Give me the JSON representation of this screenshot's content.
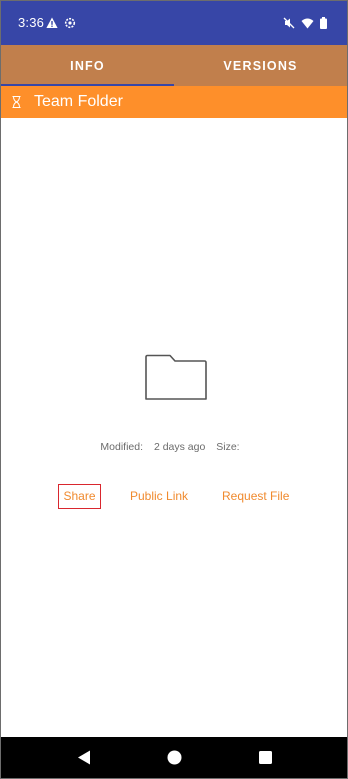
{
  "status_bar": {
    "time": "3:36",
    "icons": [
      "warning-icon",
      "settings-icon",
      "mute-icon",
      "wifi-icon",
      "battery-icon"
    ]
  },
  "tabs": [
    {
      "label": "INFO",
      "active": true
    },
    {
      "label": "VERSIONS",
      "active": false
    }
  ],
  "title_bar": {
    "icon": "hourglass-icon",
    "title": "Team Folder"
  },
  "details": {
    "icon": "folder-icon",
    "modified_label": "Modified:",
    "modified_value": "2 days ago",
    "size_label": "Size:",
    "size_value": ""
  },
  "actions": {
    "share": "Share",
    "public_link": "Public Link",
    "request_file": "Request File"
  },
  "colors": {
    "status_bar": "#3746a7",
    "tabs": "#c17f4c",
    "title_bar": "#fe8f2a",
    "action_text": "#f08a2e",
    "highlight": "#d9272e"
  },
  "nav_bar": {
    "icons": [
      "back-icon",
      "home-icon",
      "recents-icon"
    ]
  }
}
